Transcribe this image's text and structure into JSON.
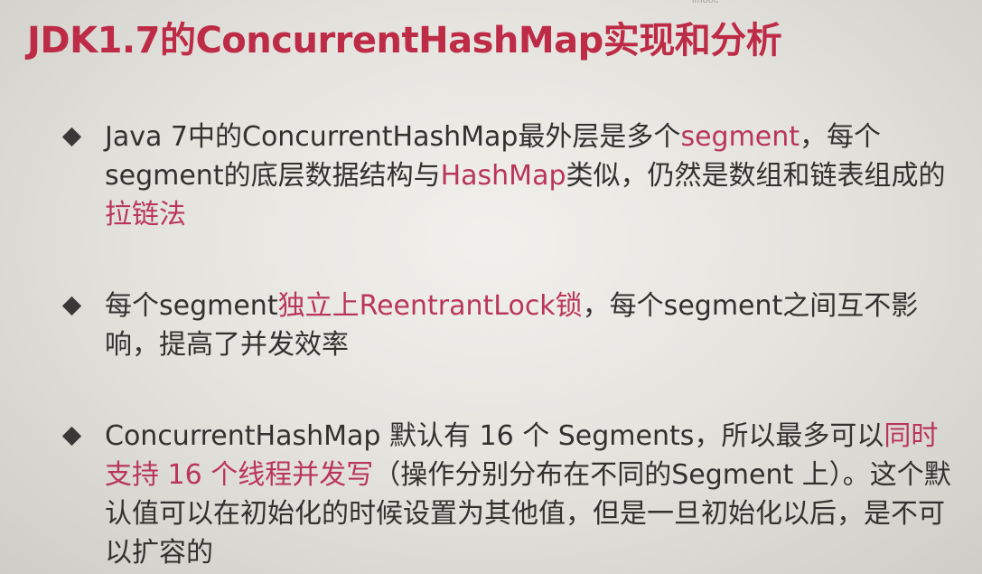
{
  "watermark": "imooc",
  "title": "JDK1.7的ConcurrentHashMap实现和分析",
  "bullets": [
    {
      "segments": [
        {
          "text": "Java 7中的ConcurrentHashMap最外层是多个",
          "highlight": false
        },
        {
          "text": "segment",
          "highlight": true
        },
        {
          "text": "，每个segment的底层数据结构与",
          "highlight": false
        },
        {
          "text": "HashMap",
          "highlight": true
        },
        {
          "text": "类似，仍然是数组和链表组成的",
          "highlight": false
        },
        {
          "text": "拉链法",
          "highlight": true
        }
      ]
    },
    {
      "segments": [
        {
          "text": "每个segment",
          "highlight": false
        },
        {
          "text": "独立上ReentrantLock锁",
          "highlight": true
        },
        {
          "text": "，每个segment之间互不影响，提高了并发效率",
          "highlight": false
        }
      ]
    },
    {
      "segments": [
        {
          "text": "ConcurrentHashMap 默认有 16 个 Segments，所以最多可以",
          "highlight": false
        },
        {
          "text": "同时支持 16 个线程并发写",
          "highlight": true
        },
        {
          "text": "（操作分别分布在不同的Segment 上）。这个默认值可以在初始化的时候设置为其他值，但是一旦初始化以后，是不可以扩容的",
          "highlight": false
        }
      ]
    }
  ],
  "colors": {
    "title": "#bd2b47",
    "highlight": "#b9365a",
    "body_text": "#33312f",
    "background": "#e8e6e1"
  },
  "icons": {
    "bullet": "diamond-bullet-icon"
  }
}
